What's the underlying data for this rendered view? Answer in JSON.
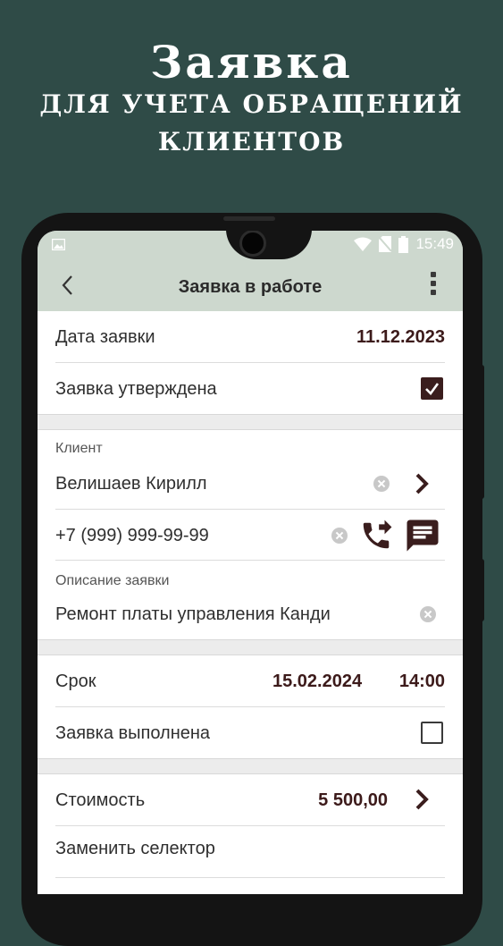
{
  "promo": {
    "title": "Заявка",
    "subtitle_line1": "для учета обращений",
    "subtitle_line2": "клиентов"
  },
  "status_bar": {
    "time": "15:49"
  },
  "app_bar": {
    "title": "Заявка в работе"
  },
  "form": {
    "request_date_label": "Дата заявки",
    "request_date_value": "11.12.2023",
    "approved_label": "Заявка утверждена",
    "approved_checked": true,
    "client_section_label": "Клиент",
    "client_value": "Велишаев Кирилл",
    "phone_value": "+7 (999) 999-99-99",
    "description_section_label": "Описание заявки",
    "description_value": "Ремонт платы управления Канди",
    "deadline_label": "Срок",
    "deadline_date": "15.02.2024",
    "deadline_time": "14:00",
    "completed_label": "Заявка выполнена",
    "completed_checked": false,
    "cost_label": "Стоимость",
    "cost_value": "5 500,00",
    "cost_item_1": "Заменить селектор"
  },
  "colors": {
    "background": "#2f4b47",
    "app_bar": "#cdd8ce",
    "accent": "#3a1d1d"
  }
}
